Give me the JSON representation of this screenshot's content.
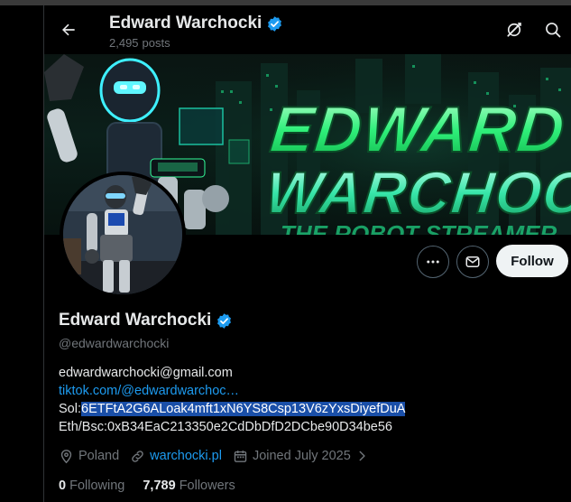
{
  "header": {
    "name": "Edward Warchocki",
    "posts_count": "2,495",
    "posts_label": "posts"
  },
  "banner": {
    "title_line1": "EDWARD",
    "title_line2": "WARCHOCKI",
    "subtitle": "THE ROBOT STREAMER"
  },
  "actions": {
    "follow_label": "Follow"
  },
  "profile": {
    "name": "Edward Warchocki",
    "handle": "@edwardwarchocki",
    "bio": {
      "email": "edwardwarchocki@gmail.com",
      "link": "tiktok.com/@edwardwarchoc…",
      "sol_prefix": "Sol:",
      "sol_address": "6ETFtA2G6ALoak4mft1xN6YS8Csp13V6zYxsDiyefDuA",
      "eth": "Eth/Bsc:0xB34EaC213350e2CdDbDfD2DCbe90D34be56"
    },
    "location": "Poland",
    "website": "warchocki.pl",
    "joined": "Joined July 2025",
    "following_count": "0",
    "following_label": "Following",
    "followers_count": "7,789",
    "followers_label": "Followers"
  },
  "colors": {
    "accent": "#1d9bf0",
    "neon_green": "#27f06a",
    "neon_cyan": "#6af0ff",
    "background": "#000000"
  },
  "icons": [
    "back-arrow-icon",
    "verified-badge-icon",
    "grok-icon",
    "search-icon",
    "more-icon",
    "message-icon",
    "location-icon",
    "link-icon",
    "calendar-icon",
    "chevron-right-icon"
  ]
}
